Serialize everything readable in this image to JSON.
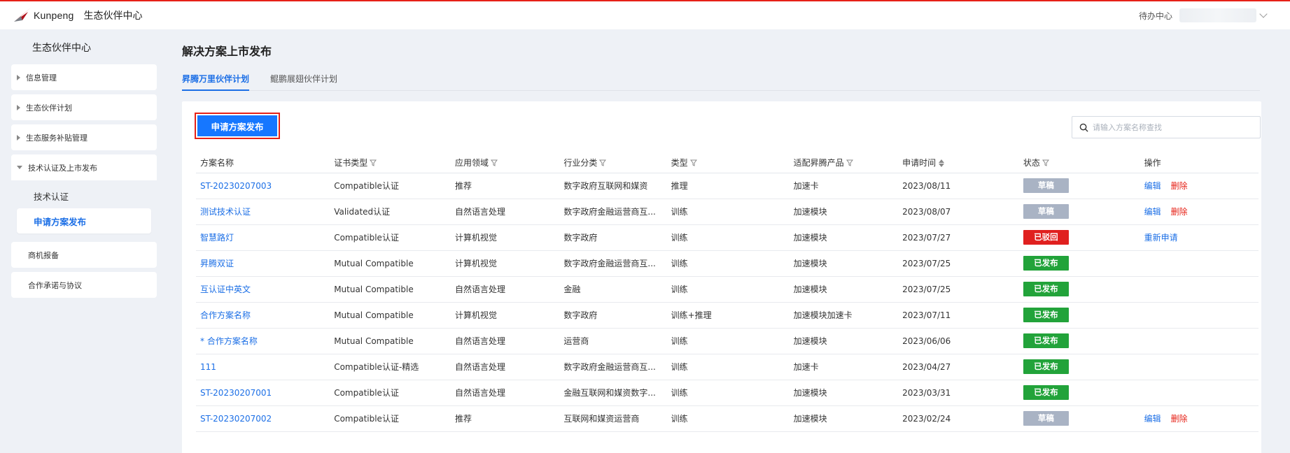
{
  "header": {
    "logo_text": "Kunpeng",
    "site_title": "生态伙伴中心",
    "todo_label": "待办中心"
  },
  "sidebar": {
    "title": "生态伙伴中心",
    "items": [
      {
        "label": "信息管理"
      },
      {
        "label": "生态伙伴计划"
      },
      {
        "label": "生态服务补贴管理"
      },
      {
        "label": "技术认证及上市发布"
      },
      {
        "label": "商机报备"
      },
      {
        "label": "合作承诺与协议"
      }
    ],
    "subitems": [
      {
        "label": "技术认证"
      },
      {
        "label": "申请方案发布"
      }
    ]
  },
  "main": {
    "page_title": "解决方案上市发布",
    "tabs": [
      {
        "label": "昇腾万里伙伴计划"
      },
      {
        "label": "鲲鹏展翅伙伴计划"
      }
    ],
    "apply_button": "申请方案发布",
    "search_placeholder": "请输入方案名称查找"
  },
  "table": {
    "columns": [
      "方案名称",
      "证书类型",
      "应用领域",
      "行业分类",
      "类型",
      "适配昇腾产品",
      "申请时间",
      "状态",
      "操作"
    ],
    "actions": {
      "edit": "编辑",
      "delete": "删除",
      "reapply": "重新申请"
    },
    "rows": [
      {
        "name": "ST-20230207003",
        "cert": "Compatible认证",
        "domain": "推荐",
        "industry": "数字政府互联网和媒资",
        "type": "推理",
        "product": "加速卡",
        "date": "2023/08/11",
        "status": "草稿"
      },
      {
        "name": "测试技术认证",
        "cert": "Validated认证",
        "domain": "自然语言处理",
        "industry": "数字政府金融运营商互...",
        "type": "训练",
        "product": "加速模块",
        "date": "2023/08/07",
        "status": "草稿"
      },
      {
        "name": "智慧路灯",
        "cert": "Compatible认证",
        "domain": "计算机视觉",
        "industry": "数字政府",
        "type": "训练",
        "product": "加速模块",
        "date": "2023/07/27",
        "status": "已驳回"
      },
      {
        "name": "昇腾双证",
        "cert": "Mutual Compatible",
        "domain": "计算机视觉",
        "industry": "数字政府金融运营商互...",
        "type": "训练",
        "product": "加速模块",
        "date": "2023/07/25",
        "status": "已发布"
      },
      {
        "name": "互认证中英文",
        "cert": "Mutual Compatible",
        "domain": "自然语言处理",
        "industry": "金融",
        "type": "训练",
        "product": "加速模块",
        "date": "2023/07/25",
        "status": "已发布"
      },
      {
        "name": "合作方案名称",
        "cert": "Mutual Compatible",
        "domain": "计算机视觉",
        "industry": "数字政府",
        "type": "训练+推理",
        "product": "加速模块加速卡",
        "date": "2023/07/11",
        "status": "已发布"
      },
      {
        "name": "* 合作方案名称",
        "cert": "Mutual Compatible",
        "domain": "自然语言处理",
        "industry": "运营商",
        "type": "训练",
        "product": "加速模块",
        "date": "2023/06/06",
        "status": "已发布"
      },
      {
        "name": "111",
        "cert": "Compatible认证-精选",
        "domain": "自然语言处理",
        "industry": "数字政府金融运营商互...",
        "type": "训练",
        "product": "加速卡",
        "date": "2023/04/27",
        "status": "已发布"
      },
      {
        "name": "ST-20230207001",
        "cert": "Compatible认证",
        "domain": "自然语言处理",
        "industry": "金融互联网和媒资数字...",
        "type": "训练",
        "product": "加速模块",
        "date": "2023/03/31",
        "status": "已发布"
      },
      {
        "name": "ST-20230207002",
        "cert": "Compatible认证",
        "domain": "推荐",
        "industry": "互联网和媒资运营商",
        "type": "训练",
        "product": "加速模块",
        "date": "2023/02/24",
        "status": "草稿"
      }
    ]
  },
  "colors": {
    "accent": "#1677ff",
    "link": "#1c6fe6",
    "danger": "#e62117",
    "status_draft": "#a9b3c4",
    "status_rejected": "#e0201f",
    "status_published": "#22a33a"
  }
}
